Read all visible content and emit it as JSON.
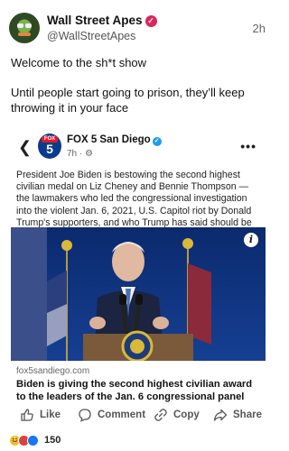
{
  "post": {
    "author": "Wall Street Apes",
    "handle": "@WallStreetApes",
    "time": "2h",
    "text_line1": "Welcome to the sh*t show",
    "text_line2": "Until people start going to prison, they’ll keep throwing it in your face"
  },
  "shared": {
    "logo_top": "FOX",
    "logo_num": "5",
    "source": "FOX 5 San Diego",
    "time": "7h · ⚙",
    "body": "President Joe Biden is bestowing the second highest civilian medal on Liz Cheney and Bennie Thompson — the lawmakers who led the congressional investigation into the violent Jan. 6, 2021, U.S. Capitol riot by Donald Trump's supporters, and who Trump has said should be jailed.",
    "domain": "fox5sandiego.com",
    "headline": "Biden is giving the second highest civilian award to the leaders of the Jan. 6 congressional panel"
  },
  "actions": {
    "like": "Like",
    "comment": "Comment",
    "copy": "Copy",
    "share": "Share"
  },
  "reactions": {
    "count": "150"
  },
  "colors": {
    "verified_badge": "#e0245e",
    "fox_blue": "#0b3c8c",
    "fox_red": "#e21d24"
  },
  "icons": [
    "chevron-left-icon",
    "more-icon",
    "info-icon",
    "like-icon",
    "comment-icon",
    "copy-icon",
    "share-icon"
  ]
}
